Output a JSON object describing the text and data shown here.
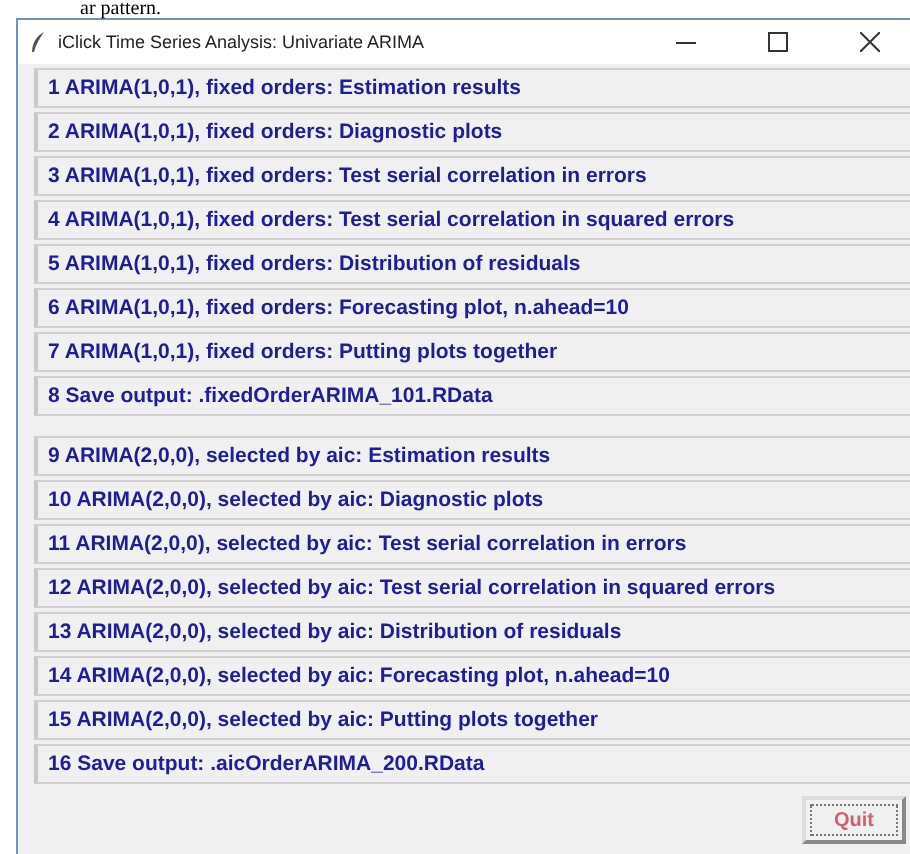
{
  "page_text_above": "ar pattern.",
  "window": {
    "title": "iClick Time Series Analysis: Univariate ARIMA"
  },
  "groups": [
    {
      "buttons": [
        "1 ARIMA(1,0,1), fixed orders: Estimation results",
        "2 ARIMA(1,0,1), fixed orders: Diagnostic plots",
        "3 ARIMA(1,0,1), fixed orders: Test serial correlation in errors",
        "4 ARIMA(1,0,1), fixed orders: Test serial correlation in squared errors",
        "5 ARIMA(1,0,1), fixed orders: Distribution of residuals",
        "6 ARIMA(1,0,1), fixed orders: Forecasting plot, n.ahead=10",
        "7 ARIMA(1,0,1), fixed orders: Putting plots together",
        "8 Save output: .fixedOrderARIMA_101.RData"
      ]
    },
    {
      "buttons": [
        "9 ARIMA(2,0,0), selected by aic: Estimation results",
        "10 ARIMA(2,0,0), selected by aic: Diagnostic plots",
        "11 ARIMA(2,0,0), selected by aic: Test serial correlation in errors",
        "12 ARIMA(2,0,0), selected by aic: Test serial correlation in squared errors",
        "13 ARIMA(2,0,0), selected by aic: Distribution of residuals",
        "14 ARIMA(2,0,0), selected by aic: Forecasting plot, n.ahead=10",
        "15 ARIMA(2,0,0), selected by aic: Putting plots together",
        "16 Save output: .aicOrderARIMA_200.RData"
      ]
    }
  ],
  "quit_button": "Quit"
}
